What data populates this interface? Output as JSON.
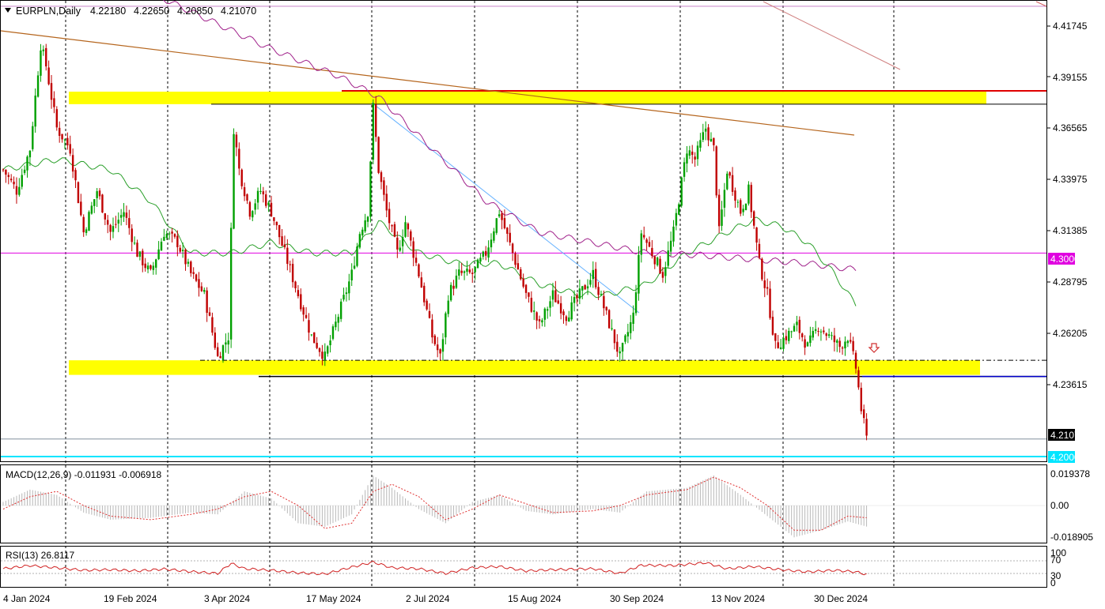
{
  "header": {
    "symbol": "EURPLN,Daily",
    "open": "4.22180",
    "high": "4.22650",
    "low": "4.20850",
    "close": "4.21070"
  },
  "price_axis": {
    "ticks": [
      "4.41745",
      "4.39155",
      "4.36565",
      "4.33975",
      "4.31385",
      "4.28795",
      "4.26205",
      "4.23615"
    ],
    "tag_level_upper": "4.30000",
    "tag_level_lower": "4.20000",
    "tag_current": "4.21070"
  },
  "macd": {
    "label": "MACD(12,26,9) -0.011931 -0.006918",
    "ticks": [
      "0.019378",
      "0.00",
      "-0.018905"
    ]
  },
  "rsi": {
    "label": "RSI(13) 26.8117",
    "ticks": [
      "100",
      "70",
      "30",
      "0"
    ]
  },
  "time_axis": {
    "labels": [
      "4 Jan 2024",
      "19 Feb 2024",
      "3 Apr 2024",
      "17 May 2024",
      "2 Jul 2024",
      "15 Aug 2024",
      "30 Sep 2024",
      "13 Nov 2024",
      "30 Dec 2024"
    ]
  },
  "colors": {
    "up_candle": "#00a000",
    "down_candle": "#c00000",
    "zone": "#ffff00",
    "level_magenta": "#e000e0",
    "level_cyan": "#00e5ff",
    "ma_green": "#2ca02c",
    "ma_purple": "#a0208a",
    "trend_brown": "#b5651d"
  },
  "chart_data": {
    "type": "candlestick",
    "symbol": "EURPLN",
    "timeframe": "Daily",
    "ylim": [
      4.2,
      4.42
    ],
    "horizontal_levels": [
      4.3,
      4.2,
      4.4185,
      4.2107
    ],
    "zones": [
      {
        "from": 4.3715,
        "to": 4.3775
      },
      {
        "from": 4.2415,
        "to": 4.2485
      }
    ],
    "close_path": [
      [
        0,
        4.34
      ],
      [
        5,
        4.33
      ],
      [
        10,
        4.35
      ],
      [
        14,
        4.4
      ],
      [
        16,
        4.39
      ],
      [
        20,
        4.36
      ],
      [
        25,
        4.35
      ],
      [
        30,
        4.31
      ],
      [
        35,
        4.33
      ],
      [
        40,
        4.31
      ],
      [
        45,
        4.32
      ],
      [
        50,
        4.3
      ],
      [
        55,
        4.29
      ],
      [
        60,
        4.31
      ],
      [
        65,
        4.305
      ],
      [
        70,
        4.29
      ],
      [
        75,
        4.28
      ],
      [
        80,
        4.25
      ],
      [
        84,
        4.26
      ],
      [
        86,
        4.36
      ],
      [
        88,
        4.34
      ],
      [
        92,
        4.32
      ],
      [
        96,
        4.33
      ],
      [
        100,
        4.32
      ],
      [
        105,
        4.3
      ],
      [
        110,
        4.28
      ],
      [
        115,
        4.26
      ],
      [
        120,
        4.25
      ],
      [
        125,
        4.27
      ],
      [
        130,
        4.29
      ],
      [
        133,
        4.31
      ],
      [
        136,
        4.32
      ],
      [
        138,
        4.37
      ],
      [
        140,
        4.34
      ],
      [
        143,
        4.32
      ],
      [
        147,
        4.3
      ],
      [
        150,
        4.315
      ],
      [
        155,
        4.29
      ],
      [
        160,
        4.26
      ],
      [
        163,
        4.25
      ],
      [
        166,
        4.28
      ],
      [
        170,
        4.29
      ],
      [
        175,
        4.29
      ],
      [
        180,
        4.3
      ],
      [
        185,
        4.32
      ],
      [
        190,
        4.3
      ],
      [
        195,
        4.28
      ],
      [
        200,
        4.265
      ],
      [
        205,
        4.28
      ],
      [
        210,
        4.27
      ],
      [
        215,
        4.28
      ],
      [
        220,
        4.29
      ],
      [
        225,
        4.27
      ],
      [
        230,
        4.25
      ],
      [
        235,
        4.27
      ],
      [
        238,
        4.31
      ],
      [
        242,
        4.3
      ],
      [
        246,
        4.29
      ],
      [
        250,
        4.31
      ],
      [
        255,
        4.35
      ],
      [
        258,
        4.345
      ],
      [
        262,
        4.36
      ],
      [
        265,
        4.35
      ],
      [
        267,
        4.31
      ],
      [
        270,
        4.34
      ],
      [
        275,
        4.32
      ],
      [
        278,
        4.33
      ],
      [
        282,
        4.295
      ],
      [
        285,
        4.28
      ],
      [
        288,
        4.255
      ],
      [
        292,
        4.26
      ],
      [
        296,
        4.265
      ],
      [
        300,
        4.255
      ],
      [
        304,
        4.265
      ],
      [
        308,
        4.26
      ],
      [
        312,
        4.255
      ],
      [
        315,
        4.26
      ],
      [
        318,
        4.245
      ],
      [
        320,
        4.225
      ],
      [
        322,
        4.2107
      ]
    ],
    "series": [
      {
        "values": [
          [
            0,
            4.34
          ],
          [
            20,
            4.345
          ],
          [
            40,
            4.34
          ],
          [
            55,
            4.325
          ],
          [
            70,
            4.3
          ],
          [
            85,
            4.3
          ],
          [
            100,
            4.305
          ],
          [
            115,
            4.3
          ],
          [
            130,
            4.3
          ],
          [
            140,
            4.315
          ],
          [
            155,
            4.3
          ],
          [
            170,
            4.295
          ],
          [
            185,
            4.295
          ],
          [
            200,
            4.285
          ],
          [
            215,
            4.28
          ],
          [
            225,
            4.28
          ],
          [
            240,
            4.285
          ],
          [
            255,
            4.3
          ],
          [
            270,
            4.31
          ],
          [
            280,
            4.316
          ],
          [
            290,
            4.313
          ],
          [
            300,
            4.305
          ],
          [
            310,
            4.29
          ],
          [
            318,
            4.275
          ]
        ]
      },
      {
        "values": [
          [
            55,
            4.425
          ],
          [
            80,
            4.41
          ],
          [
            100,
            4.398
          ],
          [
            125,
            4.385
          ],
          [
            140,
            4.375
          ],
          [
            160,
            4.35
          ],
          [
            180,
            4.325
          ],
          [
            200,
            4.31
          ],
          [
            220,
            4.305
          ],
          [
            240,
            4.3
          ],
          [
            260,
            4.299
          ],
          [
            280,
            4.297
          ],
          [
            300,
            4.295
          ],
          [
            318,
            4.292
          ]
        ]
      }
    ],
    "macd": {
      "zero": 0.0,
      "ylim": [
        -0.021,
        0.021
      ],
      "signal_path": [
        [
          0,
          -0.002
        ],
        [
          10,
          0.005
        ],
        [
          20,
          0.008
        ],
        [
          30,
          0.0
        ],
        [
          40,
          -0.006
        ],
        [
          55,
          -0.008
        ],
        [
          70,
          -0.005
        ],
        [
          80,
          -0.002
        ],
        [
          90,
          0.005
        ],
        [
          100,
          0.008
        ],
        [
          110,
          0.0
        ],
        [
          120,
          -0.013
        ],
        [
          130,
          -0.01
        ],
        [
          138,
          0.008
        ],
        [
          145,
          0.012
        ],
        [
          155,
          0.005
        ],
        [
          165,
          -0.008
        ],
        [
          175,
          -0.002
        ],
        [
          185,
          0.006
        ],
        [
          195,
          0.001
        ],
        [
          205,
          -0.004
        ],
        [
          220,
          -0.003
        ],
        [
          230,
          0.0
        ],
        [
          240,
          0.006
        ],
        [
          255,
          0.009
        ],
        [
          265,
          0.016
        ],
        [
          275,
          0.01
        ],
        [
          285,
          0.0
        ],
        [
          295,
          -0.014
        ],
        [
          305,
          -0.014
        ],
        [
          315,
          -0.006
        ],
        [
          322,
          -0.0069
        ]
      ],
      "hist_path": [
        [
          0,
          0.002
        ],
        [
          10,
          0.009
        ],
        [
          20,
          0.006
        ],
        [
          30,
          -0.004
        ],
        [
          40,
          -0.008
        ],
        [
          55,
          -0.007
        ],
        [
          70,
          -0.004
        ],
        [
          80,
          -0.005
        ],
        [
          90,
          0.008
        ],
        [
          100,
          0.004
        ],
        [
          110,
          -0.01
        ],
        [
          120,
          -0.012
        ],
        [
          130,
          -0.005
        ],
        [
          138,
          0.017
        ],
        [
          145,
          0.01
        ],
        [
          155,
          -0.002
        ],
        [
          165,
          -0.01
        ],
        [
          175,
          0.002
        ],
        [
          185,
          0.006
        ],
        [
          195,
          -0.003
        ],
        [
          205,
          -0.005
        ],
        [
          220,
          -0.002
        ],
        [
          230,
          -0.004
        ],
        [
          240,
          0.008
        ],
        [
          255,
          0.01
        ],
        [
          265,
          0.017
        ],
        [
          275,
          0.006
        ],
        [
          285,
          -0.006
        ],
        [
          295,
          -0.018
        ],
        [
          305,
          -0.014
        ],
        [
          315,
          -0.009
        ],
        [
          322,
          -0.0119
        ]
      ]
    },
    "rsi": {
      "ylim": [
        0,
        100
      ],
      "levels": [
        70,
        30
      ],
      "path": [
        [
          0,
          45
        ],
        [
          10,
          55
        ],
        [
          20,
          48
        ],
        [
          30,
          40
        ],
        [
          40,
          42
        ],
        [
          50,
          38
        ],
        [
          60,
          44
        ],
        [
          70,
          36
        ],
        [
          80,
          30
        ],
        [
          85,
          62
        ],
        [
          90,
          45
        ],
        [
          100,
          40
        ],
        [
          110,
          32
        ],
        [
          120,
          28
        ],
        [
          130,
          50
        ],
        [
          138,
          66
        ],
        [
          145,
          48
        ],
        [
          155,
          45
        ],
        [
          165,
          30
        ],
        [
          175,
          48
        ],
        [
          185,
          52
        ],
        [
          195,
          38
        ],
        [
          205,
          42
        ],
        [
          220,
          45
        ],
        [
          230,
          30
        ],
        [
          238,
          56
        ],
        [
          250,
          55
        ],
        [
          262,
          64
        ],
        [
          270,
          45
        ],
        [
          280,
          52
        ],
        [
          290,
          42
        ],
        [
          300,
          35
        ],
        [
          310,
          40
        ],
        [
          318,
          35
        ],
        [
          322,
          26.81
        ]
      ]
    }
  }
}
